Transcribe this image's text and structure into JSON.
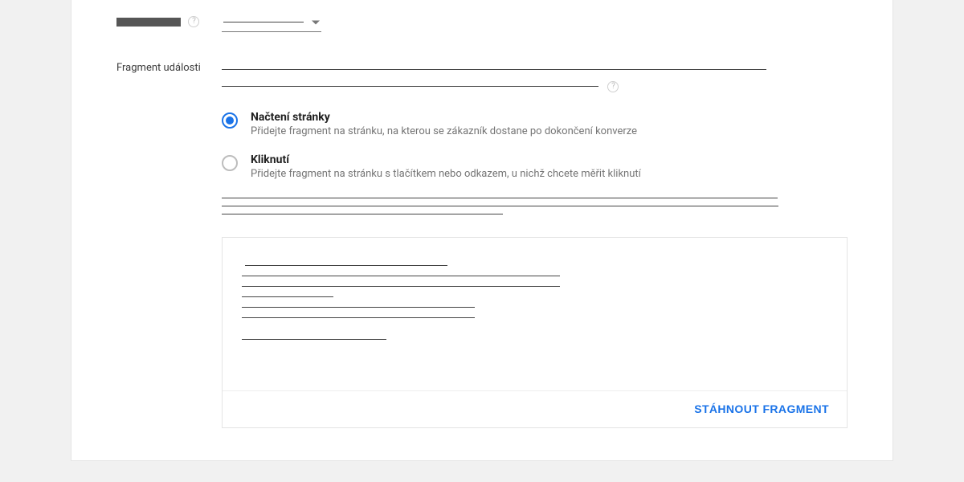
{
  "section": {
    "label": "Fragment události"
  },
  "radios": {
    "pageLoad": {
      "title": "Načtení stránky",
      "desc": "Přidejte fragment na stránku, na kterou se zákazník dostane po dokončení konverze"
    },
    "click": {
      "title": "Kliknutí",
      "desc": "Přidejte fragment na stránku s tlačítkem nebo odkazem, u nichž chcete měřit kliknutí"
    }
  },
  "actions": {
    "download": "Stáhnout fragment"
  }
}
